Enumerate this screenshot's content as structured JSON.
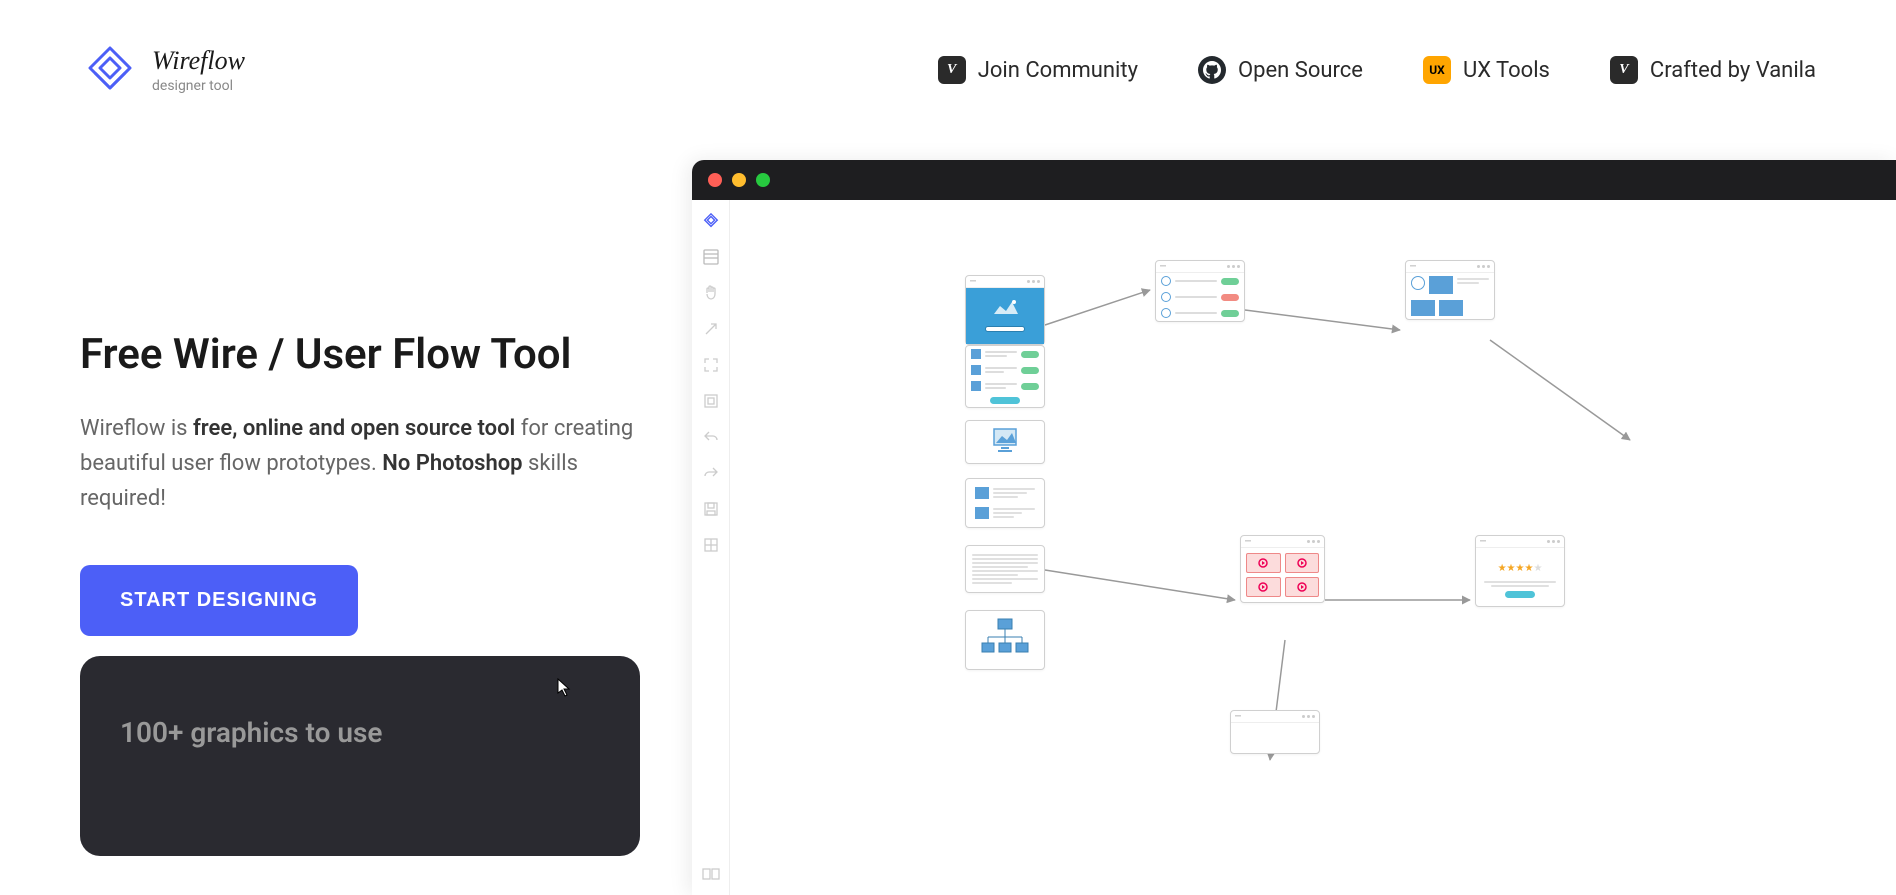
{
  "brand": {
    "name": "Wireflow",
    "tagline": "designer tool"
  },
  "nav": {
    "items": [
      {
        "label": "Join Community",
        "icon": "vanila-icon"
      },
      {
        "label": "Open Source",
        "icon": "github-icon"
      },
      {
        "label": "UX Tools",
        "icon": "ux-icon"
      },
      {
        "label": "Crafted by Vanila",
        "icon": "vanila-icon"
      }
    ]
  },
  "hero": {
    "title": "Free Wire / User Flow Tool",
    "desc_prefix": "Wireflow is ",
    "desc_strong1": "free, online and open source tool",
    "desc_mid": " for creating beautiful user flow prototypes. ",
    "desc_strong2": "No Photoshop",
    "desc_suffix": " skills required!",
    "cta": "START DESIGNING"
  },
  "feature_card": {
    "title": "100+ graphics to use"
  },
  "colors": {
    "primary": "#4c5ff7"
  }
}
